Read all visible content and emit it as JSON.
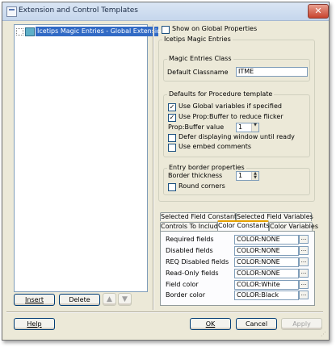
{
  "window": {
    "title": "Extension and Control Templates",
    "close_glyph": "✕"
  },
  "tree": {
    "items": [
      {
        "label": "Icetips Magic Entries - Global Extension"
      }
    ]
  },
  "left_buttons": {
    "insert": "Insert",
    "delete": "Delete",
    "up_glyph": "▲",
    "down_glyph": "▼"
  },
  "show_global": {
    "label": "Show on Global Properties",
    "checked": false
  },
  "main_group": {
    "title": "Icetips Magic Entries"
  },
  "entries_class": {
    "title": "Magic Entries Class",
    "default_label": "Default Classname",
    "default_value": "ITME"
  },
  "procedure_defaults": {
    "title": "Defaults for Procedure template",
    "use_global": {
      "label": "Use Global variables if specified",
      "checked": true
    },
    "use_prop": {
      "label": "Use Prop:Buffer to reduce flicker",
      "checked": true
    },
    "prop_buffer_label": "Prop:Buffer value",
    "prop_buffer_value": "1",
    "defer": {
      "label": "Defer displaying window until ready",
      "checked": false
    },
    "embed": {
      "label": "Use embed comments",
      "checked": false
    }
  },
  "entry_border": {
    "title": "Entry border properties",
    "thickness_label": "Border thickness",
    "thickness_value": "1",
    "round_corners": {
      "label": "Round corners",
      "checked": false
    }
  },
  "tabs": {
    "row1": [
      "Selected Field Constants",
      "Selected Field Variables"
    ],
    "row2": [
      "Controls To Include",
      "Color Constants",
      "Color Variables"
    ],
    "active": "Color Constants"
  },
  "color_fields": [
    {
      "label": "Required fields",
      "value": "COLOR:NONE"
    },
    {
      "label": "Disabled fields",
      "value": "COLOR:NONE"
    },
    {
      "label": "REQ Disabled fields",
      "value": "COLOR:NONE"
    },
    {
      "label": "Read-Only fields",
      "value": "COLOR:NONE"
    },
    {
      "label": "Field color",
      "value": "COLOR:White"
    },
    {
      "label": "Border color",
      "value": "COLOR:Black"
    }
  ],
  "ellipsis": "...",
  "bottom_buttons": {
    "help": "Help",
    "ok": "OK",
    "cancel": "Cancel",
    "apply": "Apply"
  },
  "colors": {
    "selection": "#316ac5",
    "dialog_bg": "#ece9d8",
    "tab_highlight": "#e5a100"
  }
}
